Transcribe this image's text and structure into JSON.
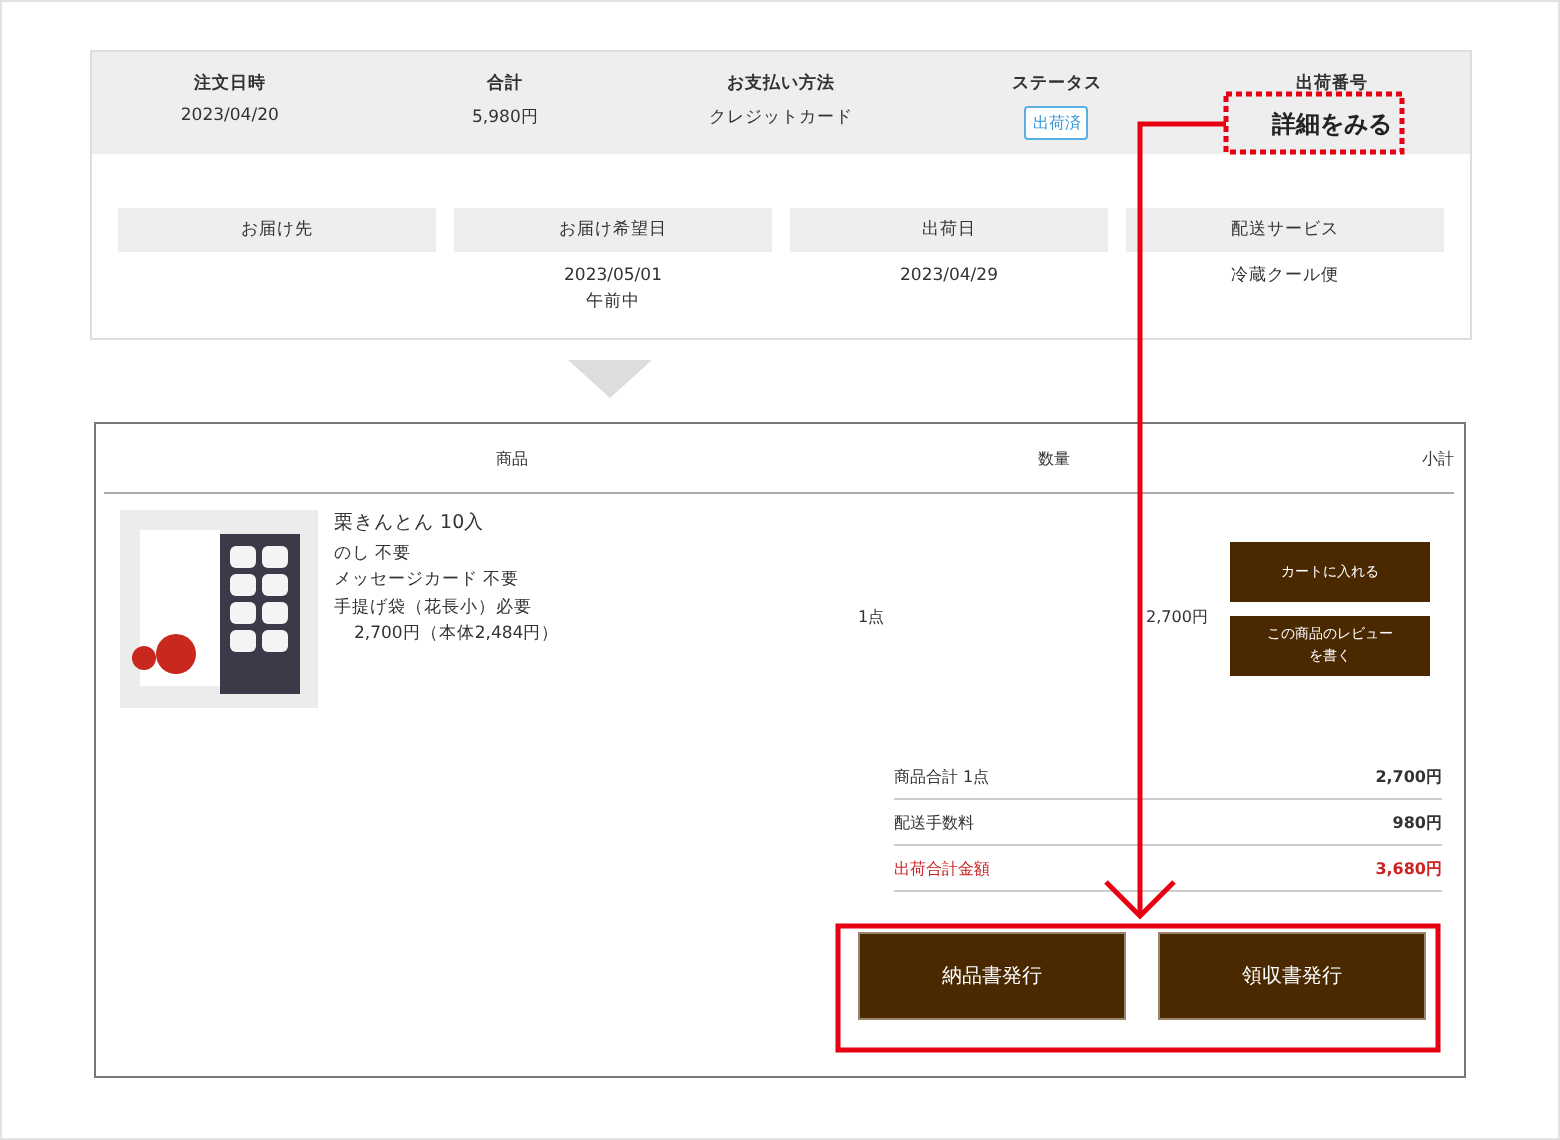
{
  "order_summary": {
    "columns": [
      {
        "label": "注文日時",
        "value": "2023/04/20",
        "kind": "text"
      },
      {
        "label": "合計",
        "value": "5,980円",
        "kind": "text"
      },
      {
        "label": "お支払い方法",
        "value": "クレジットカード",
        "kind": "text"
      },
      {
        "label": "ステータス",
        "value": "出荷済",
        "kind": "badge"
      },
      {
        "label": "出荷番号",
        "value": "詳細をみる",
        "kind": "link"
      }
    ]
  },
  "delivery": [
    {
      "label": "お届け先"
    },
    {
      "label": "お届け希望日",
      "values": [
        "2023/05/01",
        "午前中"
      ]
    },
    {
      "label": "出荷日",
      "values": [
        "2023/04/29"
      ]
    },
    {
      "label": "配送サービス",
      "values": [
        "冷蔵クール便"
      ]
    }
  ],
  "items_table": {
    "columns": [
      "商品",
      "数量",
      "小計"
    ],
    "rows": [
      {
        "image": {
          "kind": "picture"
        },
        "name": "栗きんとん 10入",
        "options": [
          "のし 不要",
          "メッセージカード 不要",
          "手提げ袋（花長小）必要"
        ],
        "price": "2,700円（本体2,484円）",
        "quantity": "1点",
        "subtotal": "2,700円",
        "buttons": [
          "カートに入れる",
          "この商品のレビューを書く"
        ]
      }
    ]
  },
  "totals": [
    {
      "label": "商品合計 1点",
      "amount": "2,700円",
      "highlight": false
    },
    {
      "label": "配送手数料",
      "amount": "980円",
      "highlight": false
    },
    {
      "label": "出荷合計金額",
      "amount": "3,680円",
      "highlight": true
    }
  ],
  "actions": [
    "納品書発行",
    "領収書発行"
  ]
}
